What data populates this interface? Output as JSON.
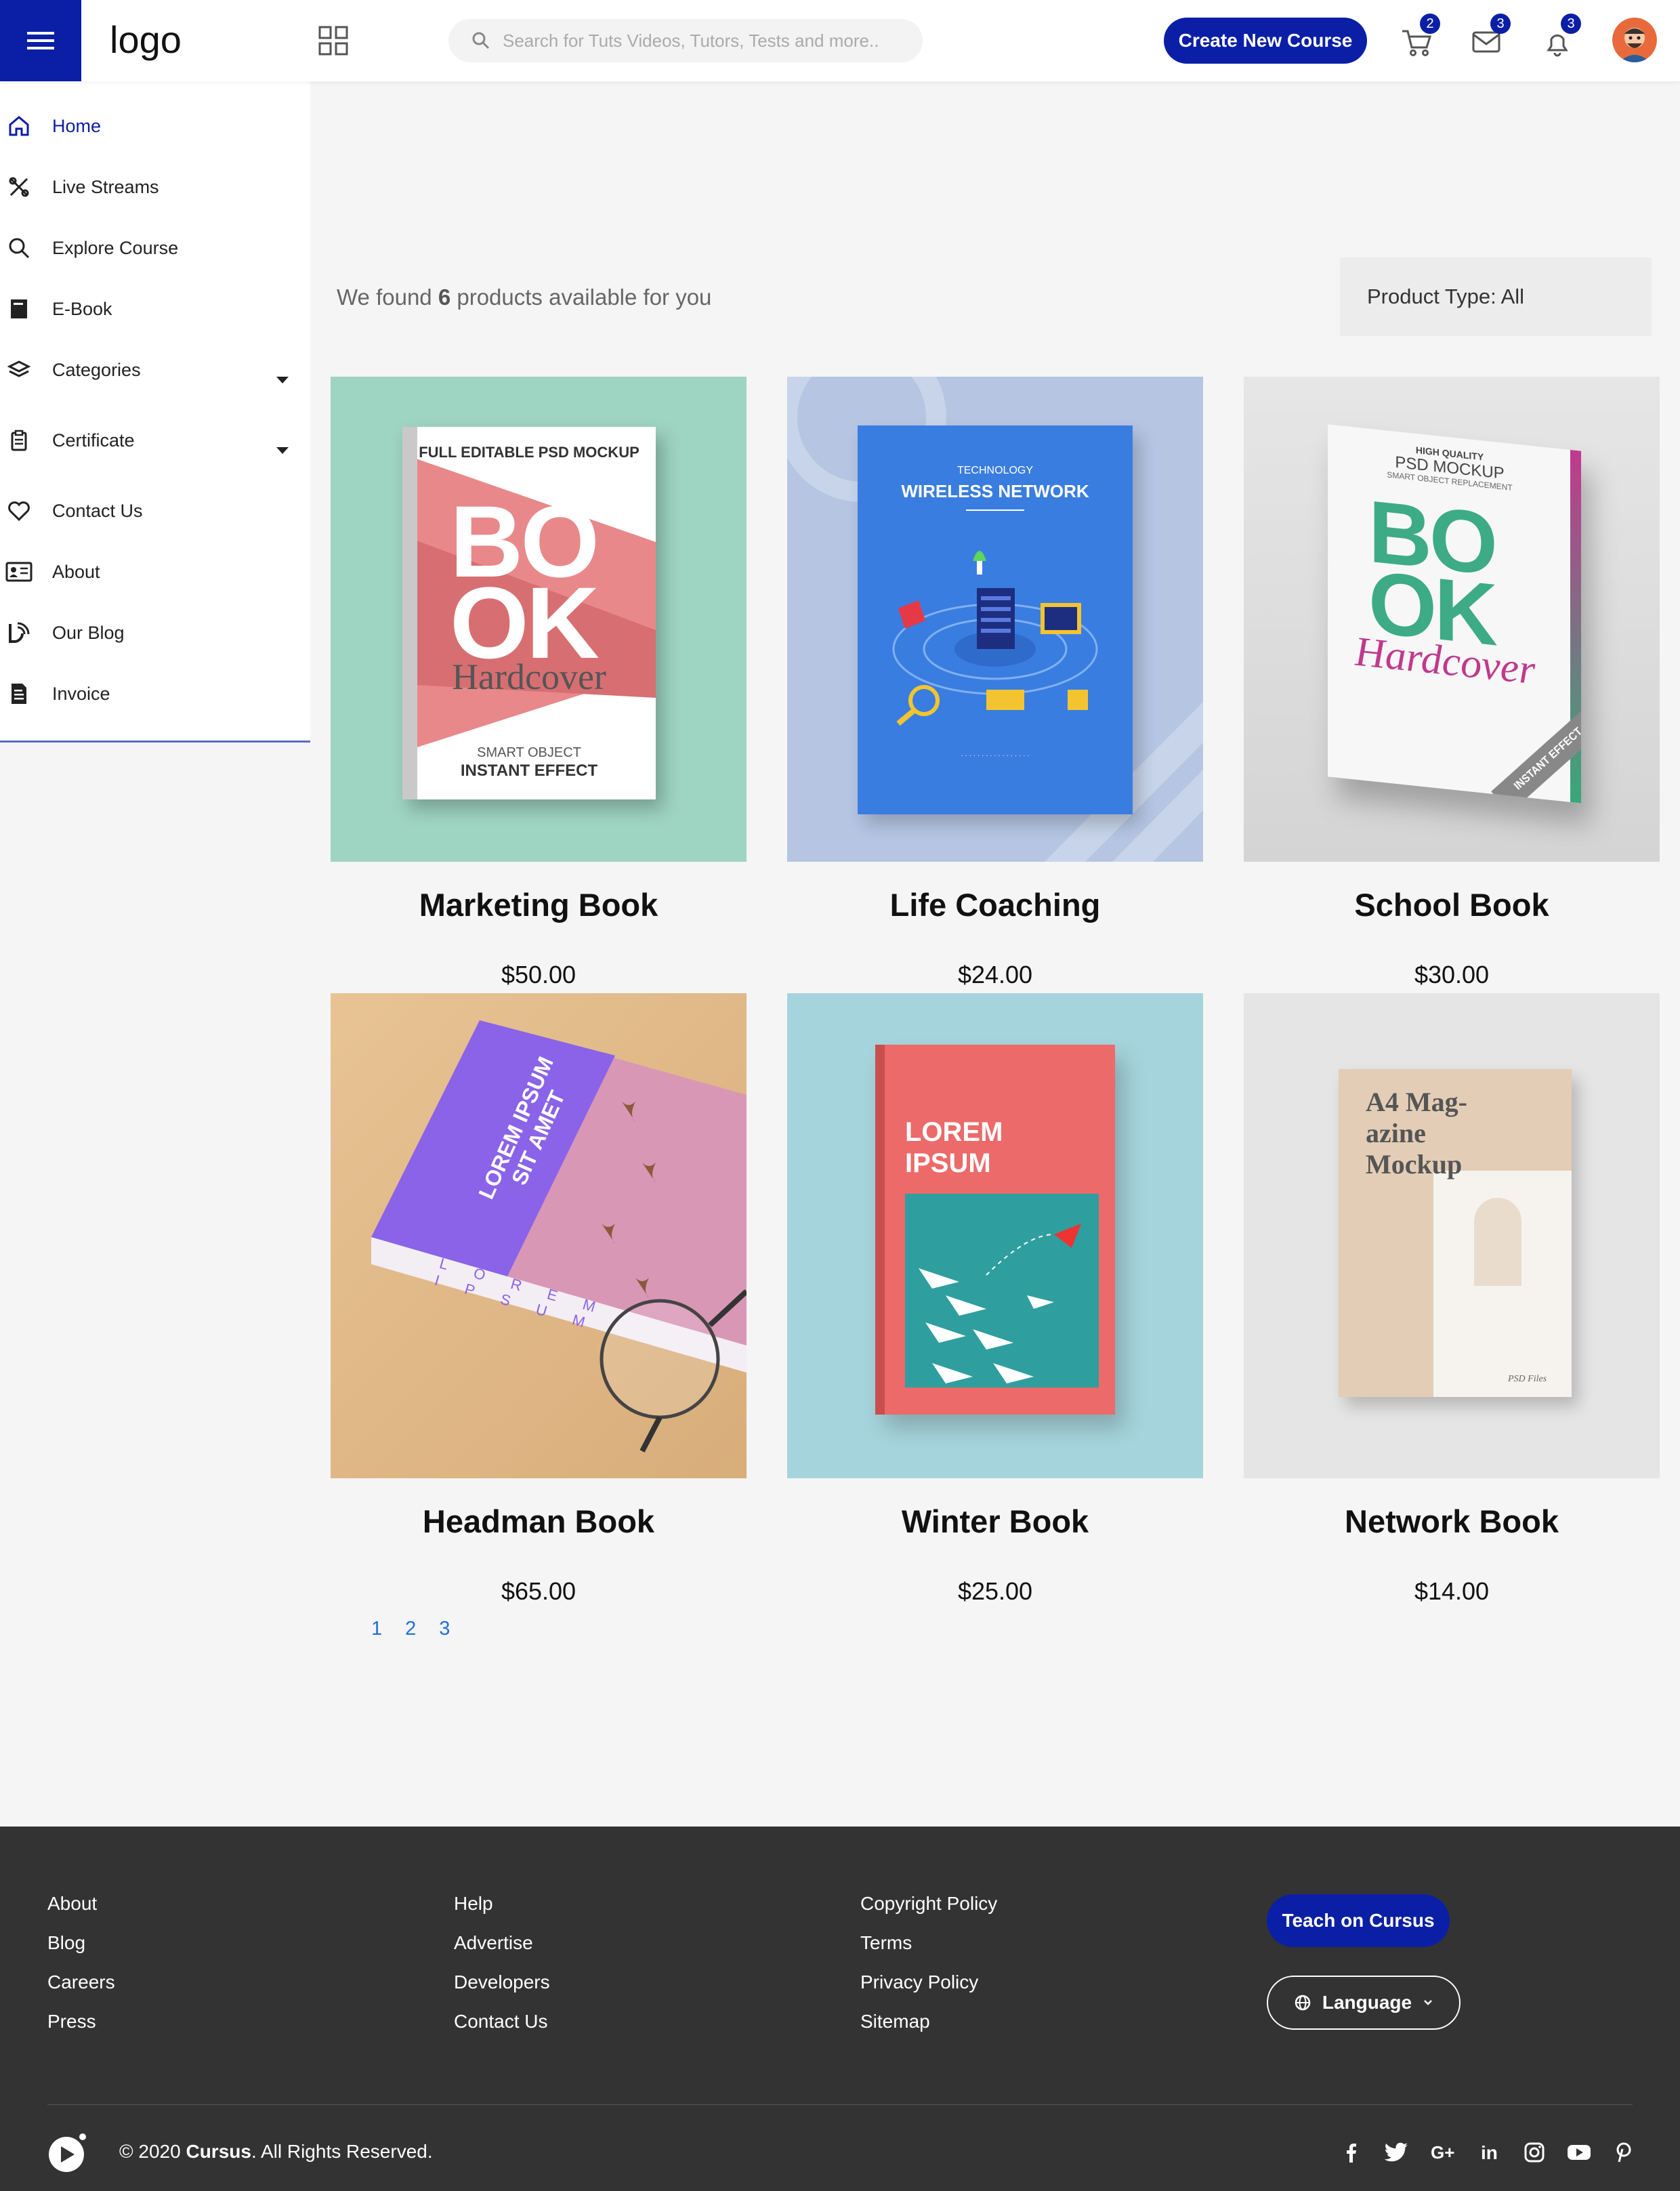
{
  "header": {
    "logo": "logo",
    "search_placeholder": "Search for Tuts Videos, Tutors, Tests and more..",
    "create_label": "Create New Course",
    "cart_count": "2",
    "messages_count": "3",
    "notifications_count": "3"
  },
  "sidebar": {
    "items": [
      {
        "label": "Home"
      },
      {
        "label": "Live Streams"
      },
      {
        "label": "Explore Course"
      },
      {
        "label": "E-Book"
      },
      {
        "label": "Categories"
      },
      {
        "label": "Certificate"
      },
      {
        "label": "Contact Us"
      },
      {
        "label": "About"
      },
      {
        "label": "Our Blog"
      },
      {
        "label": "Invoice"
      }
    ]
  },
  "main": {
    "found_prefix": "We found",
    "found_count": "6",
    "found_suffix": "products available for you",
    "product_type": "Product Type: All",
    "products": [
      {
        "name": "Marketing Book",
        "price": "$50.00",
        "cover_top": "FULL EDITABLE PSD MOCKUP",
        "cover_big1": "BO",
        "cover_big2": "OK",
        "cover_sub": "Hardcover",
        "cover_foot1": "SMART OBJECT",
        "cover_foot2": "INSTANT EFFECT"
      },
      {
        "name": "Life Coaching",
        "price": "$24.00",
        "cover_top": "TECHNOLOGY",
        "cover_title": "WIRELESS NETWORK"
      },
      {
        "name": "School Book",
        "price": "$30.00",
        "cover_top": "HIGH QUALITY",
        "cover_mid": "PSD MOCKUP",
        "cover_small": "SMART OBJECT REPLACEMENT",
        "cover_big1": "BO",
        "cover_big2": "OK",
        "cover_sub": "Hardcover",
        "cover_ribbon": "INSTANT EFFECT"
      },
      {
        "name": "Headman Book",
        "price": "$65.00",
        "cover_title": "LOREM IPSUM SIT AMET",
        "spine": "LOREM IPSUM"
      },
      {
        "name": "Winter Book",
        "price": "$25.00",
        "cover_title1": "LOREM",
        "cover_title2": "IPSUM"
      },
      {
        "name": "Network Book",
        "price": "$14.00",
        "cover_title": "A4 Mag-azine Mockup",
        "cover_foot": "PSD Files"
      }
    ],
    "pages": [
      "1",
      "2",
      "3"
    ]
  },
  "footer": {
    "col1": [
      "About",
      "Blog",
      "Careers",
      "Press"
    ],
    "col2": [
      "Help",
      "Advertise",
      "Developers",
      "Contact Us"
    ],
    "col3": [
      "Copyright Policy",
      "Terms",
      "Privacy Policy",
      "Sitemap"
    ],
    "teach_label": "Teach on Cursus",
    "language_label": "Language",
    "copyright_prefix": "© 2020",
    "copyright_brand": "Cursus",
    "copyright_suffix": ". All Rights Reserved.",
    "social": [
      "f",
      "t",
      "G+",
      "in",
      "ig",
      "yt",
      "p"
    ]
  },
  "colors": {
    "accent": "#0b1fa6",
    "footer_bg": "#333333",
    "link": "#1e6fd9"
  }
}
